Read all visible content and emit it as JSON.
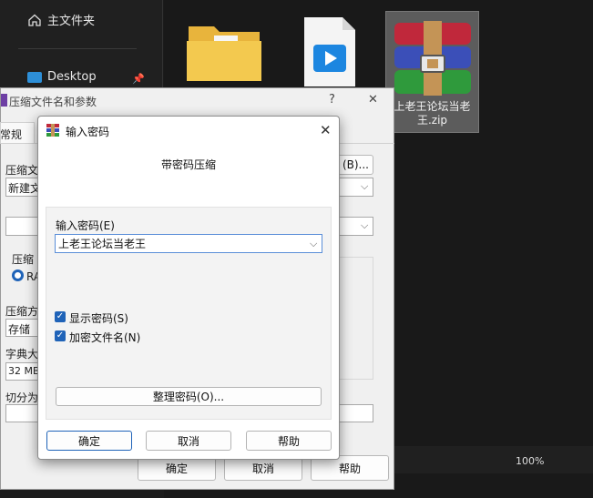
{
  "explorer": {
    "nav": {
      "home_label": "主文件夹",
      "desktop_label": "Desktop"
    },
    "files": [
      {
        "name": ""
      },
      {
        "name": ""
      },
      {
        "name": "上老王论坛当老王.zip"
      }
    ],
    "status_zoom": "100%"
  },
  "back_dialog": {
    "title": "压缩文件名和参数",
    "help_glyph": "?",
    "close_glyph": "✕",
    "tab_general": "常规",
    "archive_name_label": "压缩文",
    "archive_name_value": "新建文",
    "browse_label": "(B)...",
    "format_label": "压缩",
    "format_option": "RA",
    "method_label": "压缩方",
    "method_value": "存储",
    "dict_label": "字典大",
    "dict_value": "32 MB",
    "split_label": "切分为",
    "ok_label": "确定",
    "cancel_label": "取消",
    "help_label": "帮助"
  },
  "front_dialog": {
    "title": "输入密码",
    "close_glyph": "✕",
    "subtitle": "带密码压缩",
    "password_label": "输入密码(E)",
    "password_value": "上老王论坛当老王",
    "show_password_label": "显示密码(S)",
    "show_password_checked": true,
    "encrypt_names_label": "加密文件名(N)",
    "encrypt_names_checked": true,
    "organize_label": "整理密码(O)...",
    "ok_label": "确定",
    "cancel_label": "取消",
    "help_label": "帮助"
  },
  "colors": {
    "accent": "#1f63b8",
    "explorer_bg": "#191919",
    "dialog_bg": "#f0f0f0"
  }
}
